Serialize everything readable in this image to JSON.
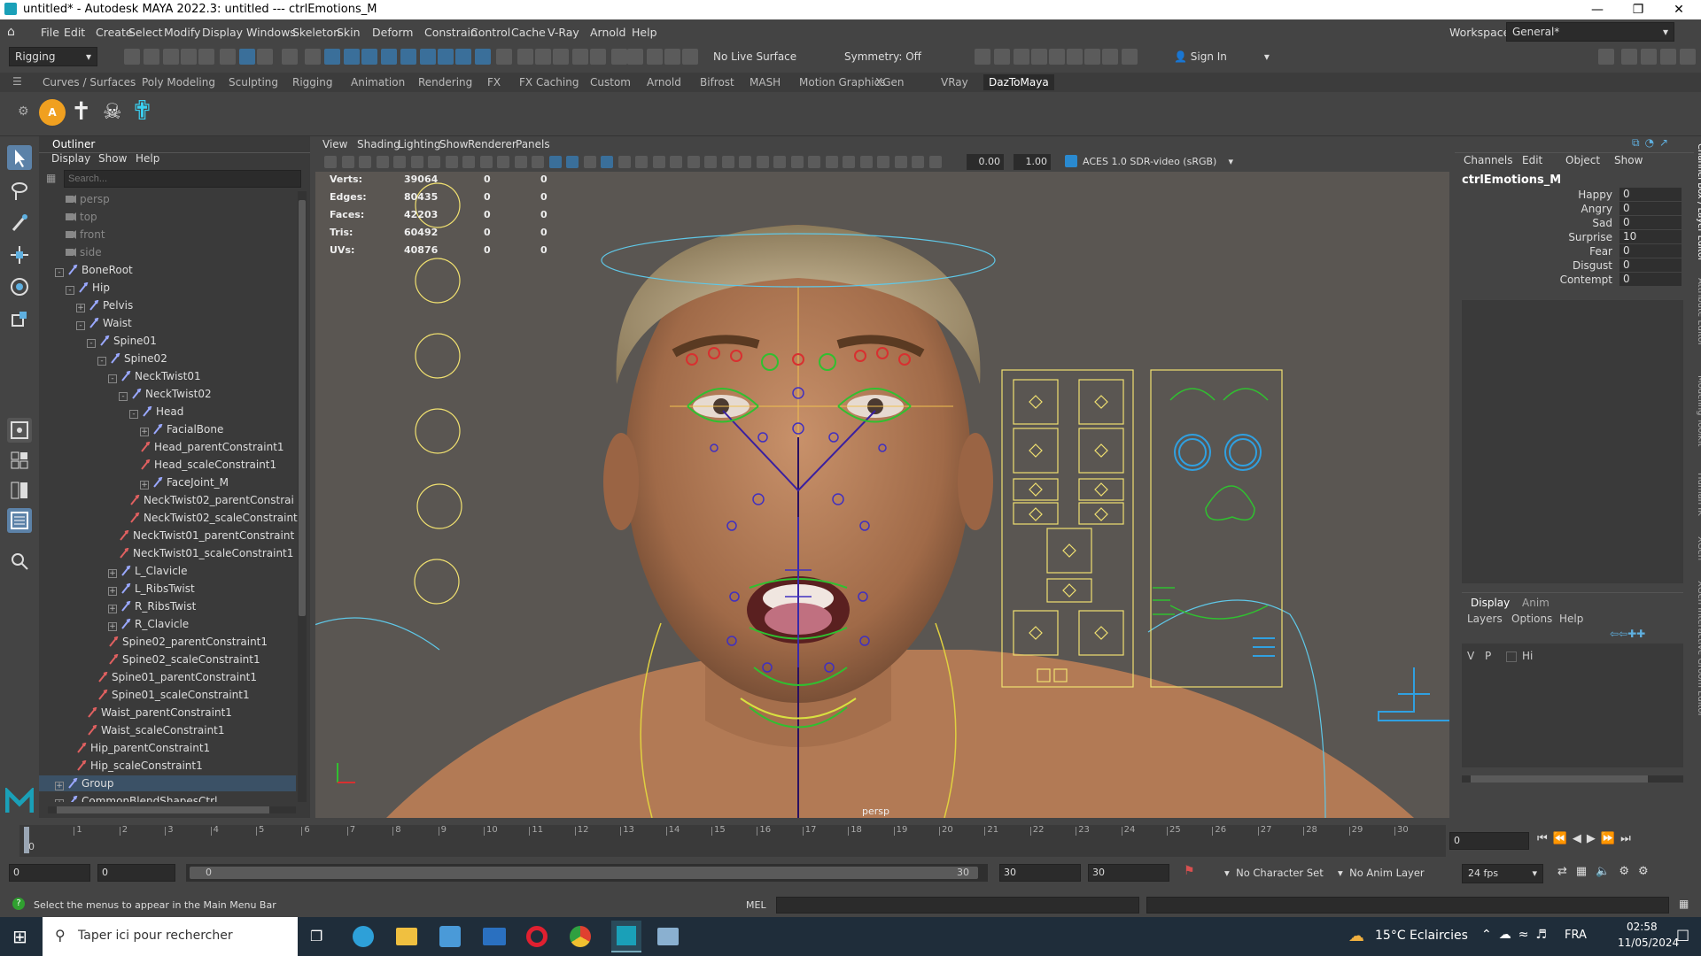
{
  "app": {
    "title": "untitled* - Autodesk MAYA 2022.3: untitled   ---   ctrlEmotions_M"
  },
  "menu": [
    "File",
    "Edit",
    "Create",
    "Select",
    "Modify",
    "Display",
    "Windows",
    "Skeleton",
    "Skin",
    "Deform",
    "Constrain",
    "Control",
    "Cache",
    "V-Ray",
    "Arnold",
    "Help"
  ],
  "workspace": {
    "label": "Workspace:",
    "value": "General*"
  },
  "toolbar": {
    "mode": "Rigging",
    "live_surface": "No Live Surface",
    "symmetry": "Symmetry: Off",
    "sign_in": "Sign In"
  },
  "shelf_tabs": [
    "Curves / Surfaces",
    "Poly Modeling",
    "Sculpting",
    "Rigging",
    "Animation",
    "Rendering",
    "FX",
    "FX Caching",
    "Custom",
    "Arnold",
    "Bifrost",
    "MASH",
    "Motion Graphics",
    "XGen",
    "VRay",
    "DazToMaya"
  ],
  "outliner": {
    "title": "Outliner",
    "menu": [
      "Display",
      "Show",
      "Help"
    ],
    "search_placeholder": "Search...",
    "rows": [
      {
        "label": "persp",
        "indent": 0,
        "type": "cam",
        "dim": true
      },
      {
        "label": "top",
        "indent": 0,
        "type": "cam",
        "dim": true
      },
      {
        "label": "front",
        "indent": 0,
        "type": "cam",
        "dim": true
      },
      {
        "label": "side",
        "indent": 0,
        "type": "cam",
        "dim": true
      },
      {
        "label": "BoneRoot",
        "indent": 0,
        "type": "joint",
        "exp": "-"
      },
      {
        "label": "Hip",
        "indent": 1,
        "type": "joint",
        "exp": "-"
      },
      {
        "label": "Pelvis",
        "indent": 2,
        "type": "joint",
        "exp": "+"
      },
      {
        "label": "Waist",
        "indent": 2,
        "type": "joint",
        "exp": "-"
      },
      {
        "label": "Spine01",
        "indent": 3,
        "type": "joint",
        "exp": "-"
      },
      {
        "label": "Spine02",
        "indent": 4,
        "type": "joint",
        "exp": "-"
      },
      {
        "label": "NeckTwist01",
        "indent": 5,
        "type": "joint",
        "exp": "-"
      },
      {
        "label": "NeckTwist02",
        "indent": 6,
        "type": "joint",
        "exp": "-"
      },
      {
        "label": "Head",
        "indent": 7,
        "type": "joint",
        "exp": "-"
      },
      {
        "label": "FacialBone",
        "indent": 8,
        "type": "joint",
        "exp": "+"
      },
      {
        "label": "Head_parentConstraint1",
        "indent": 8,
        "type": "con"
      },
      {
        "label": "Head_scaleConstraint1",
        "indent": 8,
        "type": "con"
      },
      {
        "label": "FaceJoint_M",
        "indent": 8,
        "type": "joint",
        "exp": "+"
      },
      {
        "label": "NeckTwist02_parentConstrai",
        "indent": 7,
        "type": "con"
      },
      {
        "label": "NeckTwist02_scaleConstraint",
        "indent": 7,
        "type": "con"
      },
      {
        "label": "NeckTwist01_parentConstraint",
        "indent": 6,
        "type": "con"
      },
      {
        "label": "NeckTwist01_scaleConstraint1",
        "indent": 6,
        "type": "con"
      },
      {
        "label": "L_Clavicle",
        "indent": 5,
        "type": "joint",
        "exp": "+"
      },
      {
        "label": "L_RibsTwist",
        "indent": 5,
        "type": "joint",
        "exp": "+"
      },
      {
        "label": "R_RibsTwist",
        "indent": 5,
        "type": "joint",
        "exp": "+"
      },
      {
        "label": "R_Clavicle",
        "indent": 5,
        "type": "joint",
        "exp": "+"
      },
      {
        "label": "Spine02_parentConstraint1",
        "indent": 5,
        "type": "con"
      },
      {
        "label": "Spine02_scaleConstraint1",
        "indent": 5,
        "type": "con"
      },
      {
        "label": "Spine01_parentConstraint1",
        "indent": 4,
        "type": "con"
      },
      {
        "label": "Spine01_scaleConstraint1",
        "indent": 4,
        "type": "con"
      },
      {
        "label": "Waist_parentConstraint1",
        "indent": 3,
        "type": "con"
      },
      {
        "label": "Waist_scaleConstraint1",
        "indent": 3,
        "type": "con"
      },
      {
        "label": "Hip_parentConstraint1",
        "indent": 2,
        "type": "con"
      },
      {
        "label": "Hip_scaleConstraint1",
        "indent": 2,
        "type": "con"
      },
      {
        "label": "Group",
        "indent": 0,
        "type": "grp",
        "exp": "+",
        "selected": true
      },
      {
        "label": "CommonBlendShapesCtrl",
        "indent": 0,
        "type": "grp",
        "exp": "+"
      }
    ]
  },
  "viewport": {
    "menu": [
      "View",
      "Shading",
      "Lighting",
      "Show",
      "Renderer",
      "Panels"
    ],
    "exposure": "0.00",
    "gamma": "1.00",
    "colorspace": "ACES 1.0 SDR-video (sRGB)",
    "camera": "persp",
    "hud": [
      {
        "k": "Verts:",
        "v": "39064",
        "a": "0",
        "b": "0"
      },
      {
        "k": "Edges:",
        "v": "80435",
        "a": "0",
        "b": "0"
      },
      {
        "k": "Faces:",
        "v": "42203",
        "a": "0",
        "b": "0"
      },
      {
        "k": "Tris:",
        "v": "60492",
        "a": "0",
        "b": "0"
      },
      {
        "k": "UVs:",
        "v": "40876",
        "a": "0",
        "b": "0"
      }
    ]
  },
  "channelbox": {
    "menu": [
      "Channels",
      "Edit",
      "Object",
      "Show"
    ],
    "node": "ctrlEmotions_M",
    "attrs": [
      {
        "n": "Happy",
        "v": "0"
      },
      {
        "n": "Angry",
        "v": "0"
      },
      {
        "n": "Sad",
        "v": "0"
      },
      {
        "n": "Surprise",
        "v": "10"
      },
      {
        "n": "Fear",
        "v": "0"
      },
      {
        "n": "Disgust",
        "v": "0"
      },
      {
        "n": "Contempt",
        "v": "0"
      }
    ],
    "layer_tabs": [
      "Display",
      "Anim"
    ],
    "layer_menu": [
      "Layers",
      "Options",
      "Help"
    ],
    "layer_row": {
      "v": "V",
      "p": "P",
      "name": "Hi"
    },
    "side_tabs": [
      "Channel Box / Layer Editor",
      "Attribute Editor",
      "Modeling Toolkit",
      "Human IK",
      "XGen",
      "XGen Interactive Groom Editor"
    ]
  },
  "timeline": {
    "ticks": [
      "0",
      "1",
      "2",
      "3",
      "4",
      "5",
      "6",
      "7",
      "8",
      "9",
      "10",
      "11",
      "12",
      "13",
      "14",
      "15",
      "16",
      "17",
      "18",
      "19",
      "20",
      "21",
      "22",
      "23",
      "24",
      "25",
      "26",
      "27",
      "28",
      "29",
      "30"
    ],
    "current": "0",
    "frame_field": "0"
  },
  "range": {
    "start": "0",
    "start2": "0",
    "slider_start": "0",
    "slider_end": "30",
    "end": "30",
    "end2": "30",
    "char_set": "No Character Set",
    "anim_layer": "No Anim Layer",
    "fps": "24 fps"
  },
  "cmd": {
    "help": "Select the menus to appear in the Main Menu Bar",
    "lang": "MEL"
  },
  "taskbar": {
    "search": "Taper ici pour rechercher",
    "weather": "15°C  Eclaircies",
    "lang": "FRA",
    "time": "02:58",
    "date": "11/05/2024"
  }
}
